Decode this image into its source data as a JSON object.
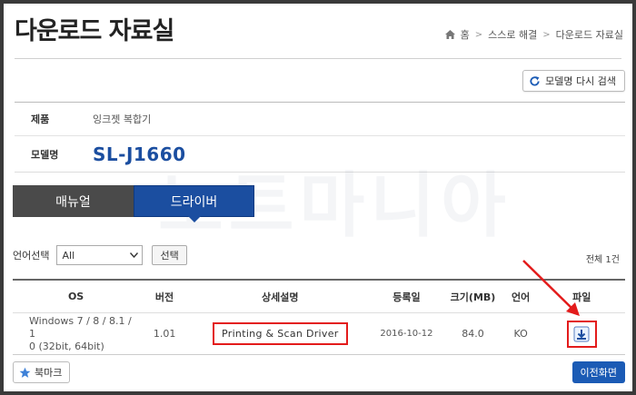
{
  "header": {
    "title": "다운로드 자료실",
    "breadcrumb": [
      "홈",
      "스스로 해결",
      "다운로드 자료실"
    ]
  },
  "toolbar": {
    "research_label": "모델명 다시 검색"
  },
  "product_info": {
    "product_label": "제품",
    "product_value": "잉크젯 복합기",
    "model_label": "모델명",
    "model_value": "SL-J1660"
  },
  "watermark": "노트마니아",
  "tabs": [
    {
      "label": "매뉴얼",
      "active": false
    },
    {
      "label": "드라이버",
      "active": true
    }
  ],
  "filter": {
    "label": "언어선택",
    "selected": "All",
    "button_label": "선택",
    "total": "전체 1건"
  },
  "table": {
    "headers": [
      "OS",
      "버전",
      "상세설명",
      "등록일",
      "크기(MB)",
      "언어",
      "파일"
    ],
    "rows": [
      {
        "os_line1": "Windows 7 / 8 / 8.1 / 1",
        "os_line2": "0 (32bit, 64bit)",
        "version": "1.01",
        "description": "Printing & Scan Driver",
        "date": "2016-10-12",
        "size": "84.0",
        "lang": "KO"
      }
    ]
  },
  "footer": {
    "bookmark_label": "북마크",
    "prev_label": "이전화면"
  },
  "colors": {
    "brand_blue": "#1b4ea0",
    "highlight_red": "#e31b1b",
    "tab_dark": "#4a4a4a"
  }
}
